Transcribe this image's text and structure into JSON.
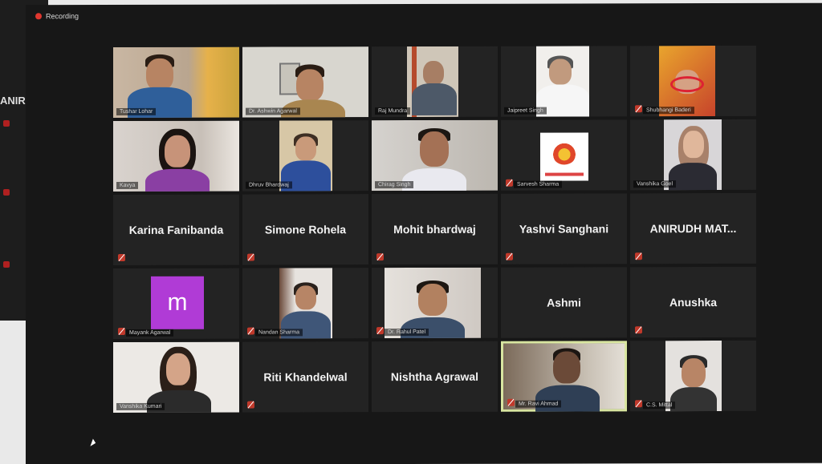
{
  "background_window": {
    "partial_name": "ANIR"
  },
  "window": {
    "recording_label": "Recording"
  },
  "participants": [
    {
      "id": "p1",
      "display": "video",
      "tag": "Tushar Lohar",
      "muted": false
    },
    {
      "id": "p2",
      "display": "video",
      "tag": "Dr. Ashwin Agarwal",
      "muted": false
    },
    {
      "id": "p3",
      "display": "video",
      "tag": "Raj Mundra",
      "muted": false
    },
    {
      "id": "p4",
      "display": "video",
      "tag": "Jaipreet Singh",
      "muted": false
    },
    {
      "id": "p5",
      "display": "video",
      "tag": "Shubhangi Baderi",
      "muted": true
    },
    {
      "id": "p6",
      "display": "video",
      "tag": "Kavya",
      "muted": false
    },
    {
      "id": "p7",
      "display": "video",
      "tag": "Dhruv Bhardwaj",
      "muted": false
    },
    {
      "id": "p8",
      "display": "video",
      "tag": "Chirag Singh",
      "muted": false
    },
    {
      "id": "p9",
      "display": "logo",
      "tag": "Sarvesh Sharma",
      "muted": true
    },
    {
      "id": "p10",
      "display": "video",
      "tag": "Vanshika Goel",
      "muted": false
    },
    {
      "id": "p11",
      "display": "name",
      "name": "Karina Fanibanda",
      "muted": true
    },
    {
      "id": "p12",
      "display": "name",
      "name": "Simone Rohela",
      "muted": true
    },
    {
      "id": "p13",
      "display": "name",
      "name": "Mohit bhardwaj",
      "muted": true
    },
    {
      "id": "p14",
      "display": "name",
      "name": "Yashvi Sanghani",
      "muted": true
    },
    {
      "id": "p15",
      "display": "name",
      "name": "ANIRUDH  MAT...",
      "muted": true
    },
    {
      "id": "p16",
      "display": "avatar",
      "avatar_letter": "m",
      "tag": "Mayank Agarwal",
      "muted": true
    },
    {
      "id": "p17",
      "display": "video",
      "tag": "Nandan Sharma",
      "muted": true
    },
    {
      "id": "p18",
      "display": "video",
      "tag": "Dr. Rahul Patel",
      "muted": true
    },
    {
      "id": "p19",
      "display": "name",
      "name": "Ashmi",
      "muted": false
    },
    {
      "id": "p20",
      "display": "name",
      "name": "Anushka",
      "muted": true
    },
    {
      "id": "p21",
      "display": "video",
      "tag": "Vanshika Kumari",
      "muted": false
    },
    {
      "id": "p22",
      "display": "name",
      "name": "Riti Khandelwal",
      "muted": true
    },
    {
      "id": "p23",
      "display": "name",
      "name": "Nishtha  Agrawal",
      "muted": false
    },
    {
      "id": "p24",
      "display": "video",
      "tag": "Mr. Ravi Ahmad",
      "muted": true,
      "speaking": true
    },
    {
      "id": "p25",
      "display": "video",
      "tag": "C.S. Mittal",
      "muted": true
    }
  ],
  "colors": {
    "window_bg": "#171717",
    "tile_bg": "#232323",
    "active_speaker_border": "#d8e5a0",
    "mute_red": "#c0392b",
    "avatar_purple": "#b03bd6"
  }
}
